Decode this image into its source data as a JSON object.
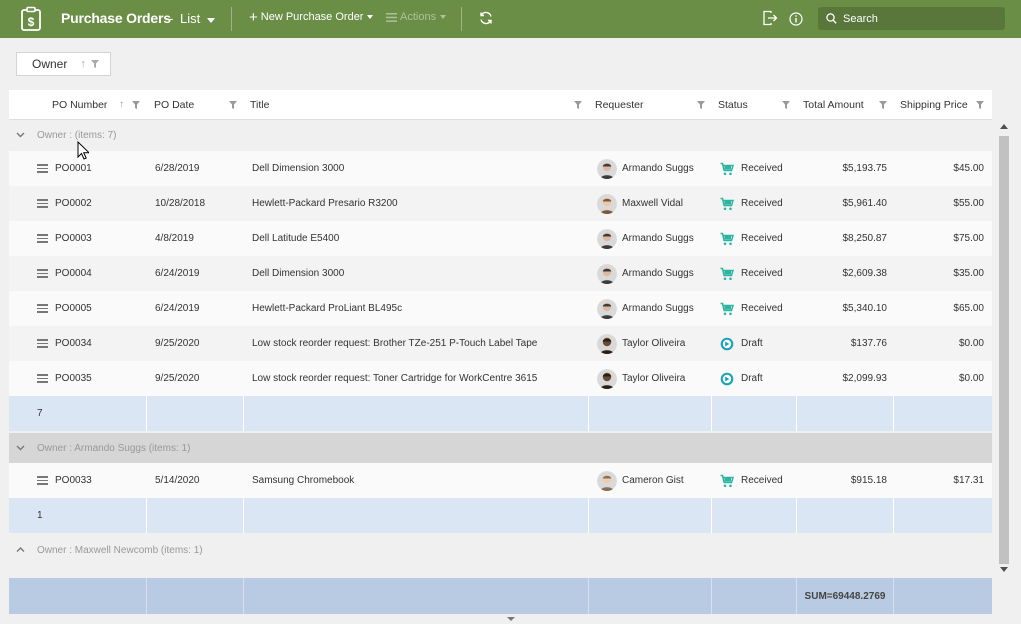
{
  "topbar": {
    "title": "Purchase Orders",
    "separator": "-",
    "view": "List",
    "new_button": "New Purchase Order",
    "actions_button": "Actions",
    "search_placeholder": "Search"
  },
  "group_panel": {
    "chip_label": "Owner"
  },
  "columns": [
    "PO Number",
    "PO Date",
    "Title",
    "Requester",
    "Status",
    "Total Amount",
    "Shipping Price"
  ],
  "groups": [
    {
      "label": "Owner : (items: 7)",
      "expanded": true,
      "rows": [
        {
          "po": "PO0001",
          "date": "6/28/2019",
          "title": "Dell Dimension 3000",
          "requester": "Armando Suggs",
          "status": "Received",
          "total": "$5,193.75",
          "shipping": "$45.00"
        },
        {
          "po": "PO0002",
          "date": "10/28/2018",
          "title": "Hewlett-Packard Presario R3200",
          "requester": "Maxwell Vidal",
          "status": "Received",
          "total": "$5,961.40",
          "shipping": "$55.00"
        },
        {
          "po": "PO0003",
          "date": "4/8/2019",
          "title": "Dell Latitude E5400",
          "requester": "Armando Suggs",
          "status": "Received",
          "total": "$8,250.87",
          "shipping": "$75.00"
        },
        {
          "po": "PO0004",
          "date": "6/24/2019",
          "title": "Dell Dimension 3000",
          "requester": "Armando Suggs",
          "status": "Received",
          "total": "$2,609.38",
          "shipping": "$35.00"
        },
        {
          "po": "PO0005",
          "date": "6/24/2019",
          "title": "Hewlett-Packard ProLiant BL495c",
          "requester": "Armando Suggs",
          "status": "Received",
          "total": "$5,340.10",
          "shipping": "$65.00"
        },
        {
          "po": "PO0034",
          "date": "9/25/2020",
          "title": "Low stock reorder request: Brother TZe-251 P-Touch Label Tape",
          "requester": "Taylor Oliveira",
          "status": "Draft",
          "total": "$137.76",
          "shipping": "$0.00"
        },
        {
          "po": "PO0035",
          "date": "9/25/2020",
          "title": "Low stock reorder request: Toner Cartridge for WorkCentre 3615",
          "requester": "Taylor Oliveira",
          "status": "Draft",
          "total": "$2,099.93",
          "shipping": "$0.00"
        }
      ],
      "count": "7"
    },
    {
      "label": "Owner : Armando Suggs (items: 1)",
      "expanded": true,
      "rows": [
        {
          "po": "PO0033",
          "date": "5/14/2020",
          "title": "Samsung Chromebook",
          "requester": "Cameron Gist",
          "status": "Received",
          "total": "$915.18",
          "shipping": "$17.31"
        }
      ],
      "count": "1"
    },
    {
      "label": "Owner : Maxwell Newcomb (items: 1)",
      "expanded": false,
      "rows": [],
      "count": ""
    }
  ],
  "footer": {
    "sum": "SUM=69448.2769"
  },
  "colors": {
    "topbar": "#6b8e47",
    "summary": "#dbe6f5",
    "total": "#b9cbe2",
    "received": "#2bb5a0",
    "draft": "#1aa3b8"
  }
}
